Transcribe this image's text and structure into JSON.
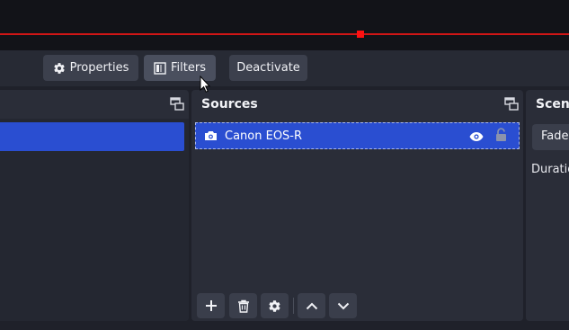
{
  "context_bar": {
    "properties_label": "Properties",
    "filters_label": "Filters",
    "deactivate_label": "Deactivate"
  },
  "sources": {
    "title": "Sources",
    "items": [
      {
        "name": "Canon EOS-R",
        "icon": "camera-icon",
        "visible": true,
        "locked": false
      }
    ],
    "toolbar_icons": [
      "plus-icon",
      "trash-icon",
      "gear-icon",
      "chevron-up-icon",
      "chevron-down-icon"
    ]
  },
  "transitions": {
    "title": "Scene",
    "selected": "Fade",
    "duration_label": "Duratio"
  },
  "colors": {
    "accent": "#2a4ed1",
    "preview_line": "#d01616",
    "panel_bg": "#2a2d38"
  }
}
